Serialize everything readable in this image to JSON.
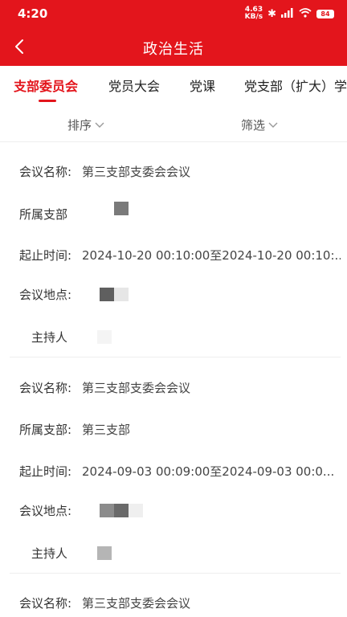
{
  "status": {
    "time": "4:20",
    "net_speed_value": "4.63",
    "net_speed_unit": "KB/s",
    "battery": "84"
  },
  "header": {
    "title": "政治生活"
  },
  "tabs": [
    {
      "label": "支部委员会"
    },
    {
      "label": "党员大会"
    },
    {
      "label": "党课"
    },
    {
      "label": "党支部（扩大）学"
    }
  ],
  "filters": {
    "sort": "排序",
    "filter": "筛选"
  },
  "records": [
    {
      "name_label": "会议名称:",
      "name": "第三支部支委会会议",
      "branch_label": "所属支部",
      "branch": "",
      "time_label": "起止时间:",
      "time": "2024-10-20 00:10:00至2024-10-20 00:10:...",
      "place_label": "会议地点:",
      "host_label": "主持人"
    },
    {
      "name_label": "会议名称:",
      "name": "第三支部支委会会议",
      "branch_label": "所属支部:",
      "branch": "第三支部",
      "time_label": "起止时间:",
      "time": "2024-09-03 00:09:00至2024-09-03 00:0...",
      "place_label": "会议地点:",
      "host_label": "主持人"
    },
    {
      "name_label": "会议名称:",
      "name": "第三支部支委会会议"
    }
  ],
  "colors": {
    "accent": "#e3151c"
  }
}
